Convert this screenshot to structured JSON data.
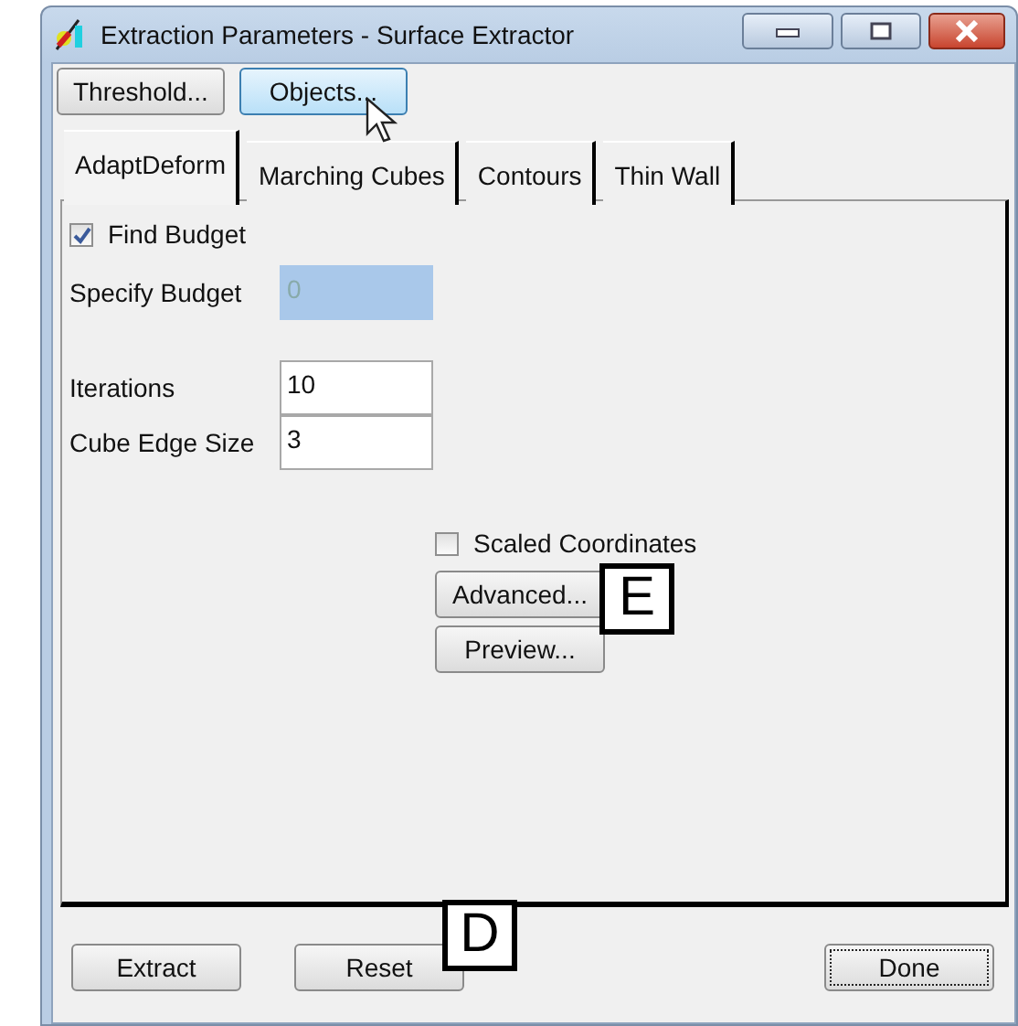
{
  "window": {
    "title": "Extraction Parameters - Surface Extractor"
  },
  "top_buttons": [
    {
      "label": "Threshold...",
      "hovered": false
    },
    {
      "label": "Objects...",
      "hovered": true
    }
  ],
  "tabs": [
    {
      "label": "AdaptDeform",
      "selected": true
    },
    {
      "label": "Marching Cubes",
      "selected": false
    },
    {
      "label": "Contours",
      "selected": false
    },
    {
      "label": "Thin Wall",
      "selected": false
    }
  ],
  "find_budget": {
    "label": "Find Budget",
    "checked": true
  },
  "fields": [
    {
      "label": "Specify Budget",
      "value": "0",
      "disabled": true
    },
    {
      "label": "Iterations",
      "value": "10",
      "disabled": false
    },
    {
      "label": "Cube Edge Size",
      "value": "3",
      "disabled": false
    }
  ],
  "scaled_coordinates": {
    "label": "Scaled Coordinates",
    "checked": false
  },
  "panel_buttons": [
    "Advanced...",
    "Preview..."
  ],
  "bottom_buttons": [
    {
      "label": "Extract",
      "focused": false
    },
    {
      "label": "Reset",
      "focused": false
    },
    {
      "label": "Done",
      "focused": true
    }
  ],
  "callouts": [
    "E",
    "D"
  ]
}
